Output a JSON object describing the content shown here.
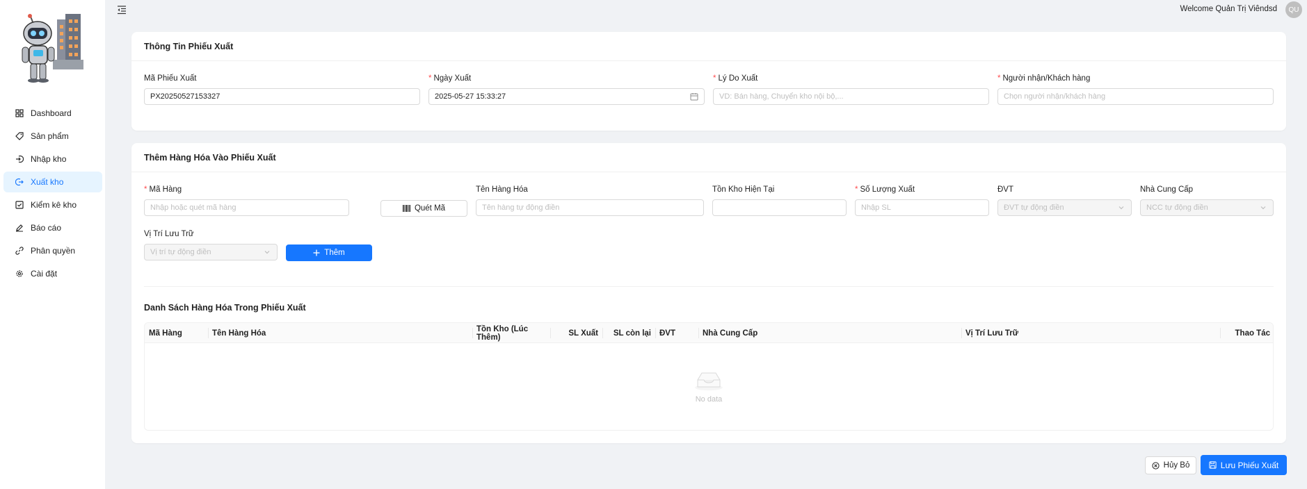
{
  "sidebar": {
    "items": [
      {
        "label": "Dashboard",
        "icon": "grid-icon"
      },
      {
        "label": "Sản phẩm",
        "icon": "tag-icon"
      },
      {
        "label": "Nhập kho",
        "icon": "login-icon"
      },
      {
        "label": "Xuất kho",
        "icon": "logout-icon"
      },
      {
        "label": "Kiểm kê kho",
        "icon": "checkbox-icon"
      },
      {
        "label": "Báo cáo",
        "icon": "edit-icon"
      },
      {
        "label": "Phân quyền",
        "icon": "link-icon"
      },
      {
        "label": "Cài đặt",
        "icon": "gear-icon"
      }
    ],
    "active_index": 3
  },
  "header": {
    "welcome": "Welcome Quản Trị Viêndsd",
    "avatar_initials": "QU"
  },
  "info_card": {
    "title": "Thông Tin Phiếu Xuất",
    "code_label": "Mã Phiếu Xuất",
    "code_value": "PX20250527153327",
    "date_label": "Ngày Xuất",
    "date_value": "2025-05-27 15:33:27",
    "reason_label": "Lý Do Xuất",
    "reason_placeholder": "VD: Bán hàng, Chuyển kho nội bộ,...",
    "receiver_label": "Người nhận/Khách hàng",
    "receiver_placeholder": "Chọn người nhận/khách hàng"
  },
  "add_card": {
    "title": "Thêm Hàng Hóa Vào Phiếu Xuất",
    "item_code_label": "Mã Hàng",
    "item_code_placeholder": "Nhập hoặc quét mã hàng",
    "scan_label": "Quét Mã",
    "item_name_label": "Tên Hàng Hóa",
    "item_name_placeholder": "Tên hàng tự động điền",
    "stock_label": "Tồn Kho Hiện Tại",
    "stock_value": "",
    "qty_label": "Số Lượng Xuất",
    "qty_placeholder": "Nhập SL",
    "unit_label": "ĐVT",
    "unit_placeholder": "ĐVT tự động điền",
    "supplier_label": "Nhà Cung Cấp",
    "supplier_placeholder": "NCC tự động điền",
    "location_label": "Vị Trí Lưu Trữ",
    "location_placeholder": "Vị trí tự động điền",
    "add_label": "Thêm",
    "list_title": "Danh Sách Hàng Hóa Trong Phiếu Xuất",
    "columns": [
      "Mã Hàng",
      "Tên Hàng Hóa",
      "Tồn Kho (Lúc Thêm)",
      "SL Xuất",
      "SL còn lại",
      "ĐVT",
      "Nhà Cung Cấp",
      "Vị Trí Lưu Trữ",
      "Thao Tác"
    ],
    "empty_text": "No data"
  },
  "footer": {
    "cancel_label": "Hủy Bỏ",
    "save_label": "Lưu Phiếu Xuất"
  },
  "colors": {
    "primary": "#1677ff",
    "active_bg": "#e6f4ff",
    "required": "#ff4d4f"
  }
}
